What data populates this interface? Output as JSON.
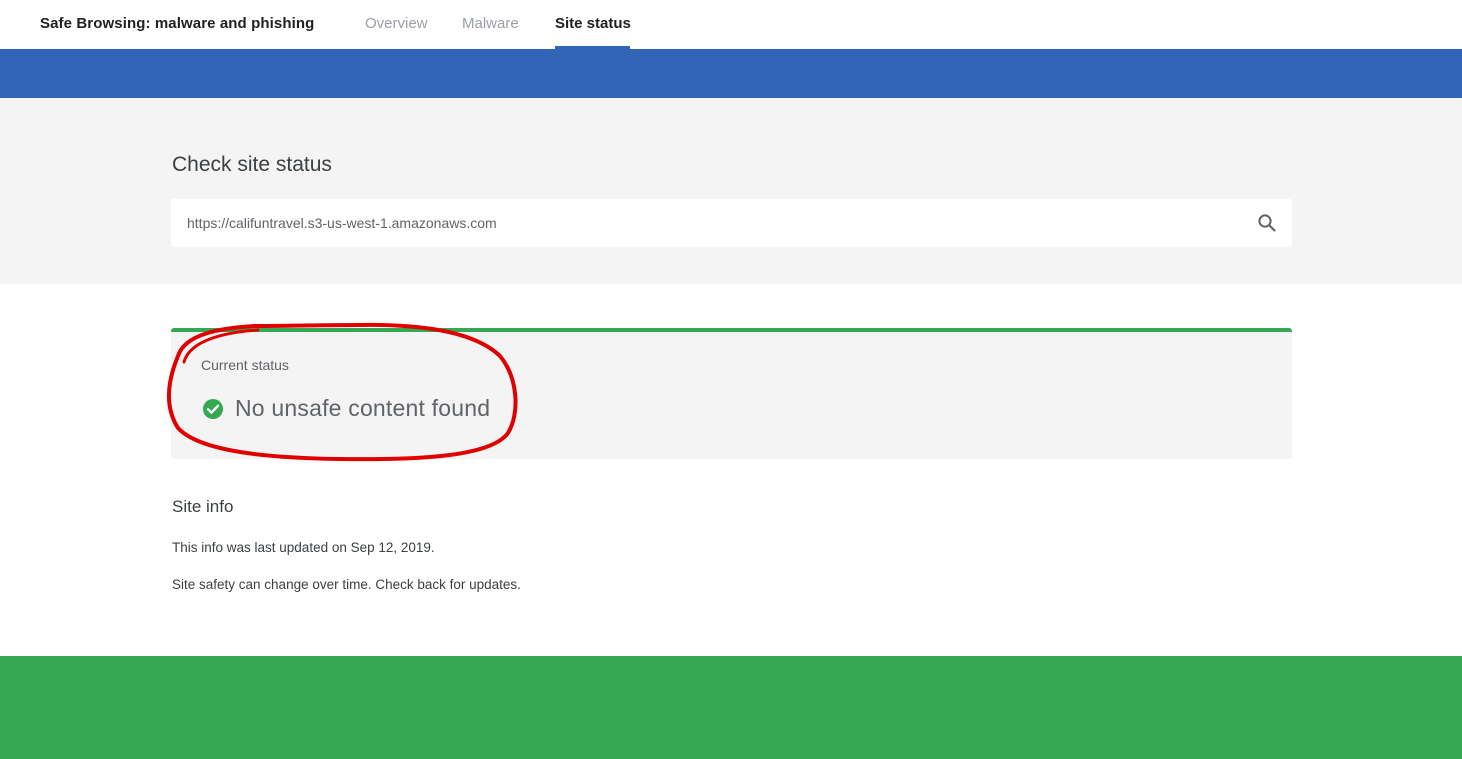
{
  "header": {
    "brand": "Safe Browsing: malware and phishing",
    "tabs": [
      {
        "label": "Overview"
      },
      {
        "label": "Malware"
      },
      {
        "label": "Site status"
      }
    ]
  },
  "check": {
    "title": "Check site status",
    "url_value": "https://califuntravel.s3-us-west-1.amazonaws.com"
  },
  "status": {
    "label": "Current status",
    "result": "No unsafe content found"
  },
  "site_info": {
    "title": "Site info",
    "updated": "This info was last updated on Sep 12, 2019.",
    "note": "Site safety can change over time. Check back for updates."
  },
  "colors": {
    "blue_band": "#3264b7",
    "green_accent": "#34a853",
    "annotation_red": "#e00000"
  },
  "icons": {
    "search": "search-icon",
    "status": "check-circle-icon"
  }
}
